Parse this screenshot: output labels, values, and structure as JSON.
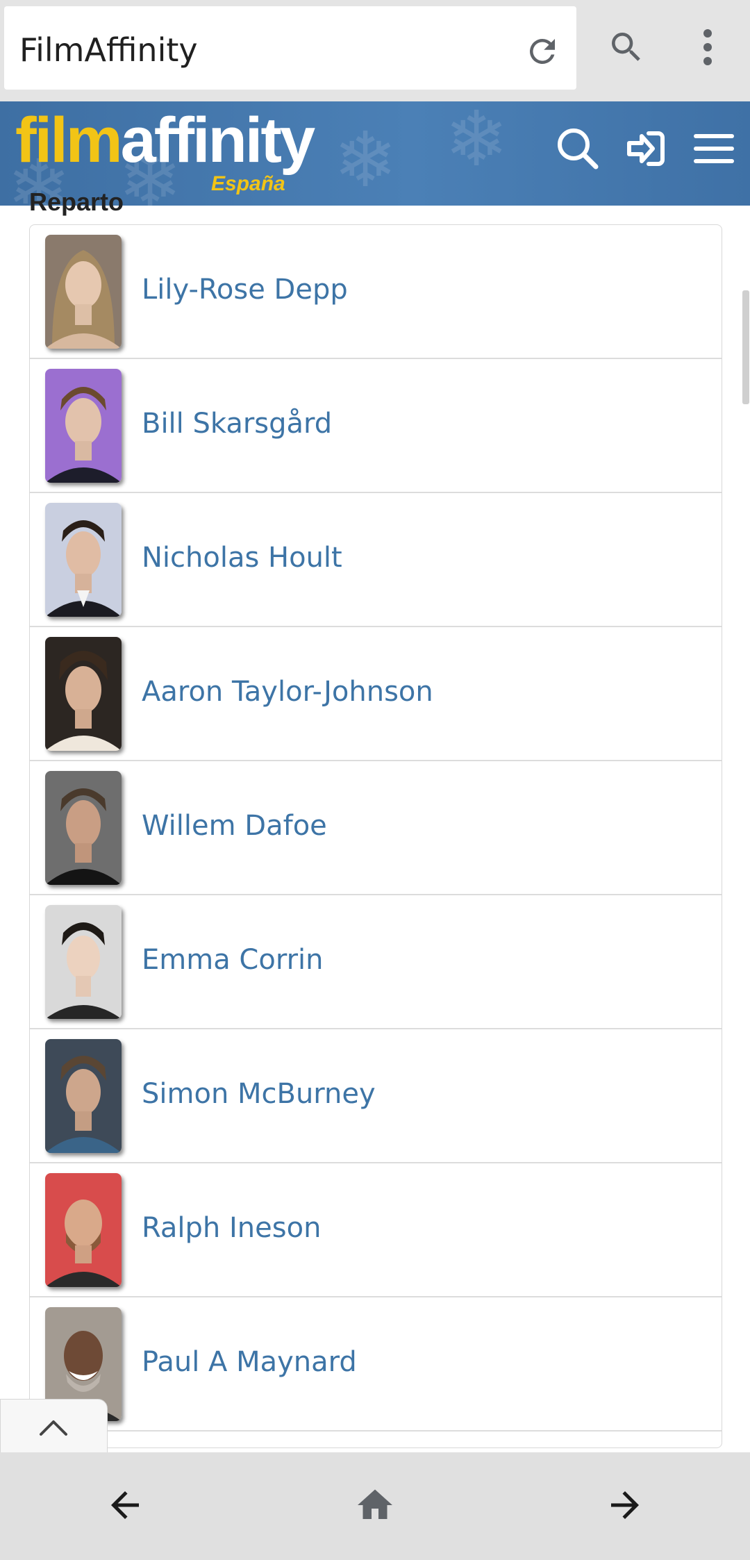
{
  "browser": {
    "url_title": "FilmAffinity",
    "icons": [
      "reload-icon",
      "search-icon",
      "more-vert-icon"
    ]
  },
  "site": {
    "logo_film": "film",
    "logo_affinity": "affinity",
    "logo_country": "España",
    "brand_blue": "#4b80b6",
    "brand_yellow": "#f2c416",
    "icons": [
      "search-icon",
      "login-icon",
      "menu-icon"
    ]
  },
  "section": {
    "title": "Reparto"
  },
  "cast": [
    {
      "name": "Lily-Rose Depp"
    },
    {
      "name": "Bill Skarsgård"
    },
    {
      "name": "Nicholas Hoult"
    },
    {
      "name": "Aaron Taylor-Johnson"
    },
    {
      "name": "Willem Dafoe"
    },
    {
      "name": "Emma Corrin"
    },
    {
      "name": "Simon McBurney"
    },
    {
      "name": "Ralph Ineson"
    },
    {
      "name": "Paul A Maynard"
    }
  ],
  "link_color": "#3d74a6",
  "bottom_nav": [
    "back-arrow-icon",
    "home-icon",
    "forward-arrow-icon"
  ]
}
